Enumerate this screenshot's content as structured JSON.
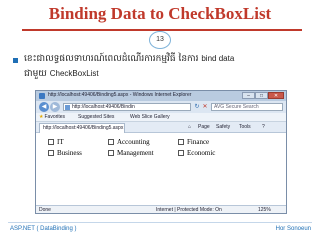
{
  "slide": {
    "title": "Binding Data to CheckBoxList",
    "page_number": "13",
    "description_line1_km": "ខេះជាលទ្ធផលទាហរណ៍ពេលដំណើរការកម្មវិធី នៃការ",
    "description_line1_en": "bind data",
    "description_line2_km": "ជាមួយ",
    "description_line2_en": "CheckBoxList",
    "footer_left": "ASP.NET ( DataBinding )",
    "footer_right": "Hor Sonoeun"
  },
  "browser": {
    "window_title": "http://localhost:49406/Binding5.aspx - Windows Internet Explorer",
    "address": "http://localhost:49406/Bindin",
    "search_placeholder": "AVG Secure Search",
    "favorites_label": "Favorites",
    "suggested_sites_label": "Suggested Sites",
    "web_slice_label": "Web Slice Gallery",
    "tab_label": "http://localhost:49406/Binding5.aspx",
    "page_menu": "Page",
    "safety_menu": "Safety",
    "tools_menu": "Tools",
    "help_icon": "help-icon",
    "status_left": "Done",
    "status_zone": "Internet | Protected Mode: On",
    "zoom": "125%"
  },
  "checkboxlist": {
    "items": [
      "IT",
      "Accounting",
      "Finance",
      "Business",
      "Management",
      "Economic"
    ],
    "checked": [
      false,
      false,
      false,
      false,
      false,
      false
    ]
  },
  "colors": {
    "title": "#c0392b",
    "accent": "#1f6fb5"
  }
}
